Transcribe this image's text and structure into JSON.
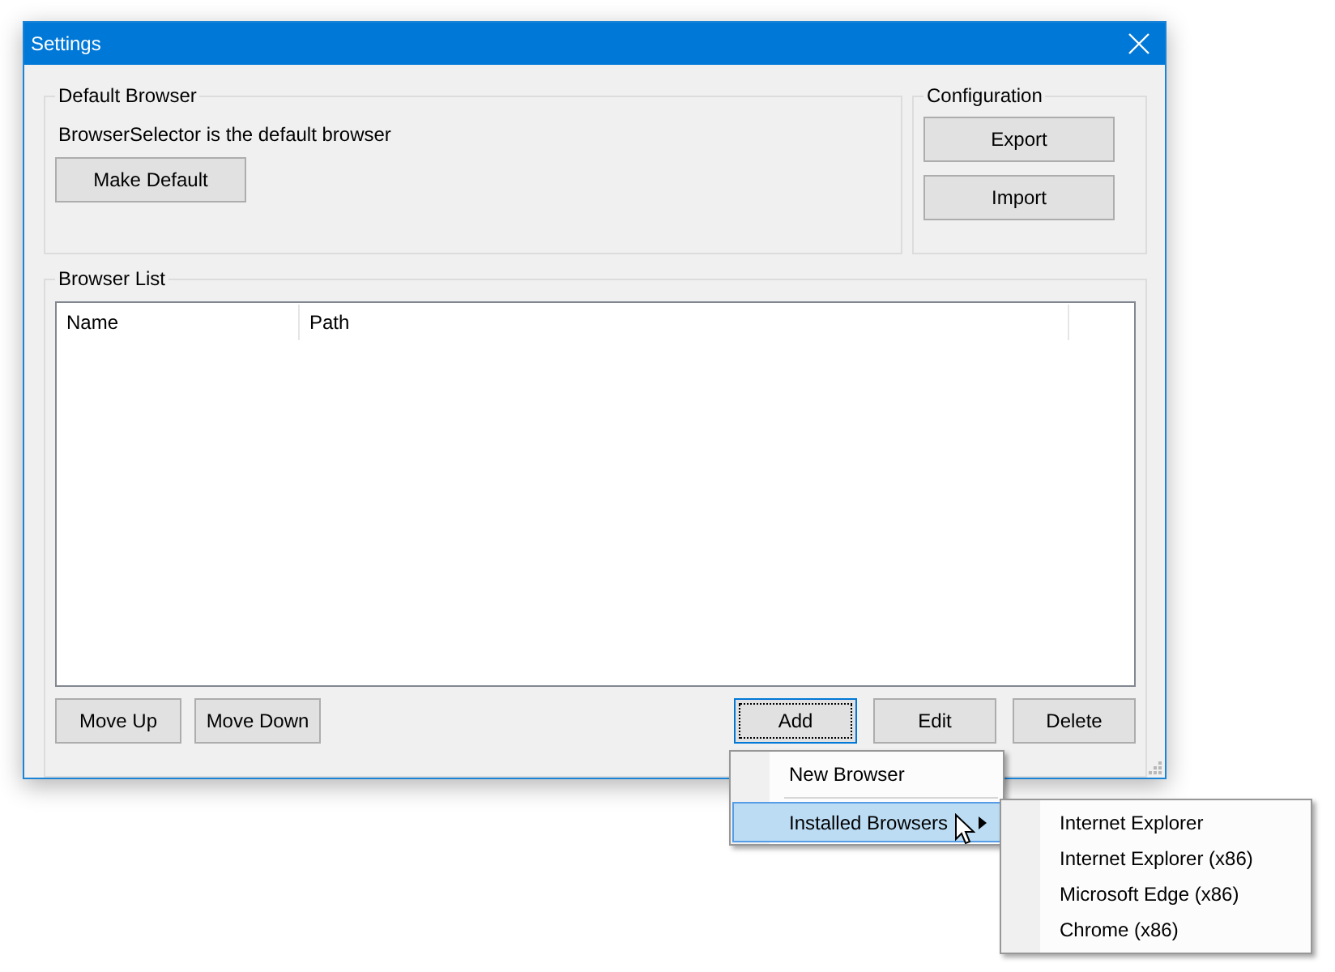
{
  "window": {
    "title": "Settings"
  },
  "default_browser": {
    "title": "Default Browser",
    "status": "BrowserSelector is the default browser",
    "button": "Make Default"
  },
  "configuration": {
    "title": "Configuration",
    "buttons": [
      "Export",
      "Import"
    ]
  },
  "browser_list": {
    "title": "Browser List",
    "columns": [
      "Name",
      "Path"
    ],
    "left_buttons": [
      {
        "label": "Move Up",
        "focused": false
      },
      {
        "label": "Move Down",
        "focused": false
      }
    ],
    "right_buttons": [
      {
        "label": "Add",
        "focused": true
      },
      {
        "label": "Edit",
        "focused": false
      },
      {
        "label": "Delete",
        "focused": false
      }
    ]
  },
  "menu": {
    "items": [
      {
        "label": "New Browser",
        "kind": "item",
        "selected": false
      },
      {
        "label": "Installed Browsers",
        "kind": "submenu",
        "selected": true
      }
    ]
  },
  "submenu": {
    "items": [
      {
        "label": "Internet Explorer",
        "selected": false
      },
      {
        "label": "Internet Explorer (x86)",
        "selected": false
      },
      {
        "label": "Microsoft Edge (x86)",
        "selected": false
      },
      {
        "label": "Chrome (x86)",
        "selected": false
      }
    ]
  }
}
